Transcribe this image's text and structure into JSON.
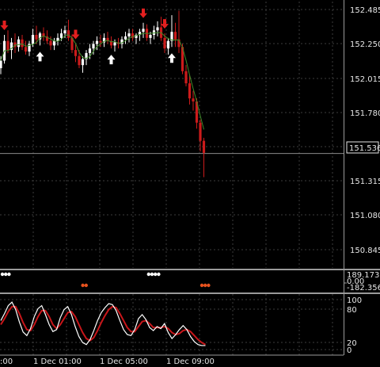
{
  "colors": {
    "background": "#000000",
    "grid": "#3c3c3c",
    "frame": "#9a9a9a",
    "bull_candle": "#ffffff",
    "bear_candle": "#cc1b1b",
    "ma_line": "#3f8a2a",
    "signal_up": "#ffffff",
    "signal_down": "#e31f1f",
    "dots_white": "#ffffff",
    "dots_orange": "#e8521e",
    "stoch_main": "#ffffff",
    "stoch_signal": "#c8161a"
  },
  "chart_data": {
    "type": "candlestick",
    "main_panel": {
      "price_axis_ticks": [
        "152.485",
        "152.250",
        "152.015",
        "151.780",
        "151.545",
        "151.315",
        "151.080",
        "150.845"
      ],
      "ylim": [
        150.78,
        152.54
      ],
      "current_price_label": "151.536",
      "current_price": 151.536,
      "candles": [
        [
          152.1,
          152.18,
          152.06,
          152.15
        ],
        [
          152.15,
          152.32,
          152.13,
          152.28
        ],
        [
          152.28,
          152.35,
          152.2,
          152.22
        ],
        [
          152.22,
          152.3,
          152.16,
          152.27
        ],
        [
          152.27,
          152.33,
          152.2,
          152.24
        ],
        [
          152.24,
          152.31,
          152.21,
          152.29
        ],
        [
          152.29,
          152.32,
          152.22,
          152.24
        ],
        [
          152.24,
          152.28,
          152.19,
          152.21
        ],
        [
          152.21,
          152.28,
          152.18,
          152.26
        ],
        [
          152.26,
          152.36,
          152.24,
          152.32
        ],
        [
          152.32,
          152.38,
          152.26,
          152.29
        ],
        [
          152.29,
          152.34,
          152.25,
          152.33
        ],
        [
          152.33,
          152.37,
          152.28,
          152.31
        ],
        [
          152.31,
          152.35,
          152.26,
          152.28
        ],
        [
          152.28,
          152.31,
          152.22,
          152.25
        ],
        [
          152.25,
          152.3,
          152.22,
          152.28
        ],
        [
          152.28,
          152.33,
          152.25,
          152.3
        ],
        [
          152.3,
          152.36,
          152.28,
          152.33
        ],
        [
          152.33,
          152.38,
          152.3,
          152.35
        ],
        [
          152.35,
          152.42,
          152.28,
          152.3
        ],
        [
          152.3,
          152.32,
          152.2,
          152.22
        ],
        [
          152.22,
          152.26,
          152.14,
          152.18
        ],
        [
          152.18,
          152.22,
          152.1,
          152.12
        ],
        [
          152.12,
          152.18,
          152.07,
          152.16
        ],
        [
          152.16,
          152.22,
          152.12,
          152.2
        ],
        [
          152.2,
          152.26,
          152.16,
          152.23
        ],
        [
          152.23,
          152.28,
          152.19,
          152.26
        ],
        [
          152.26,
          152.31,
          152.22,
          152.28
        ],
        [
          152.28,
          152.32,
          152.24,
          152.27
        ],
        [
          152.27,
          152.33,
          152.24,
          152.3
        ],
        [
          152.3,
          152.34,
          152.26,
          152.28
        ],
        [
          152.28,
          152.31,
          152.23,
          152.25
        ],
        [
          152.25,
          152.29,
          152.21,
          152.27
        ],
        [
          152.27,
          152.3,
          152.23,
          152.26
        ],
        [
          152.26,
          152.31,
          152.23,
          152.29
        ],
        [
          152.29,
          152.34,
          152.26,
          152.31
        ],
        [
          152.31,
          152.36,
          152.27,
          152.33
        ],
        [
          152.33,
          152.36,
          152.28,
          152.3
        ],
        [
          152.3,
          152.33,
          152.26,
          152.32
        ],
        [
          152.32,
          152.36,
          152.28,
          152.34
        ],
        [
          152.34,
          152.4,
          152.3,
          152.36
        ],
        [
          152.36,
          152.39,
          152.28,
          152.3
        ],
        [
          152.3,
          152.34,
          152.26,
          152.32
        ],
        [
          152.32,
          152.38,
          152.29,
          152.35
        ],
        [
          152.35,
          152.41,
          152.31,
          152.37
        ],
        [
          152.37,
          152.44,
          152.28,
          152.3
        ],
        [
          152.3,
          152.33,
          152.2,
          152.23
        ],
        [
          152.23,
          152.3,
          152.19,
          152.28
        ],
        [
          152.28,
          152.45,
          152.24,
          152.34
        ],
        [
          152.34,
          152.4,
          152.24,
          152.29
        ],
        [
          152.29,
          152.48,
          152.2,
          152.24
        ],
        [
          152.24,
          152.26,
          152.06,
          152.08
        ],
        [
          152.08,
          152.12,
          151.98,
          152.0
        ],
        [
          152.0,
          152.05,
          151.86,
          151.9
        ],
        [
          151.9,
          151.95,
          151.82,
          151.88
        ],
        [
          151.88,
          151.9,
          151.7,
          151.74
        ],
        [
          151.74,
          151.76,
          151.55,
          151.62
        ],
        [
          151.62,
          151.64,
          151.43,
          151.54
        ]
      ],
      "up_arrow_candles": [
        11,
        31,
        48
      ],
      "down_arrow_candles": [
        1,
        21,
        40,
        46
      ]
    },
    "dots_panel": {
      "axis_labels": [
        "189.1738",
        "0.00",
        "-182.3569"
      ],
      "white_dot_groups": [
        [
          0,
          2
        ],
        [
          44,
          47
        ]
      ],
      "orange_dot_groups": [
        [
          28,
          29
        ],
        [
          65,
          67
        ]
      ]
    },
    "stochastic_panel": {
      "axis_labels": [
        "100",
        "80",
        "20",
        "0"
      ],
      "main": [
        58,
        72,
        88,
        95,
        80,
        55,
        35,
        28,
        42,
        66,
        82,
        88,
        70,
        50,
        36,
        40,
        64,
        80,
        86,
        70,
        46,
        26,
        14,
        10,
        20,
        38,
        58,
        74,
        84,
        92,
        90,
        78,
        58,
        40,
        30,
        28,
        40,
        62,
        70,
        60,
        44,
        38,
        46,
        42,
        52,
        34,
        22,
        30,
        40,
        48,
        40,
        26,
        16,
        10,
        8,
        8
      ],
      "signal": [
        50,
        62,
        76,
        86,
        86,
        72,
        54,
        40,
        38,
        50,
        66,
        78,
        78,
        66,
        50,
        42,
        50,
        62,
        74,
        76,
        66,
        50,
        34,
        22,
        18,
        24,
        38,
        54,
        68,
        80,
        86,
        84,
        72,
        58,
        44,
        36,
        36,
        46,
        56,
        58,
        52,
        44,
        44,
        44,
        46,
        42,
        34,
        30,
        32,
        38,
        40,
        36,
        28,
        20,
        14,
        10
      ]
    },
    "time_axis_labels": [
      ":00",
      "1 Dec 01:00",
      "1 Dec 05:00",
      "1 Dec 09:00"
    ]
  }
}
